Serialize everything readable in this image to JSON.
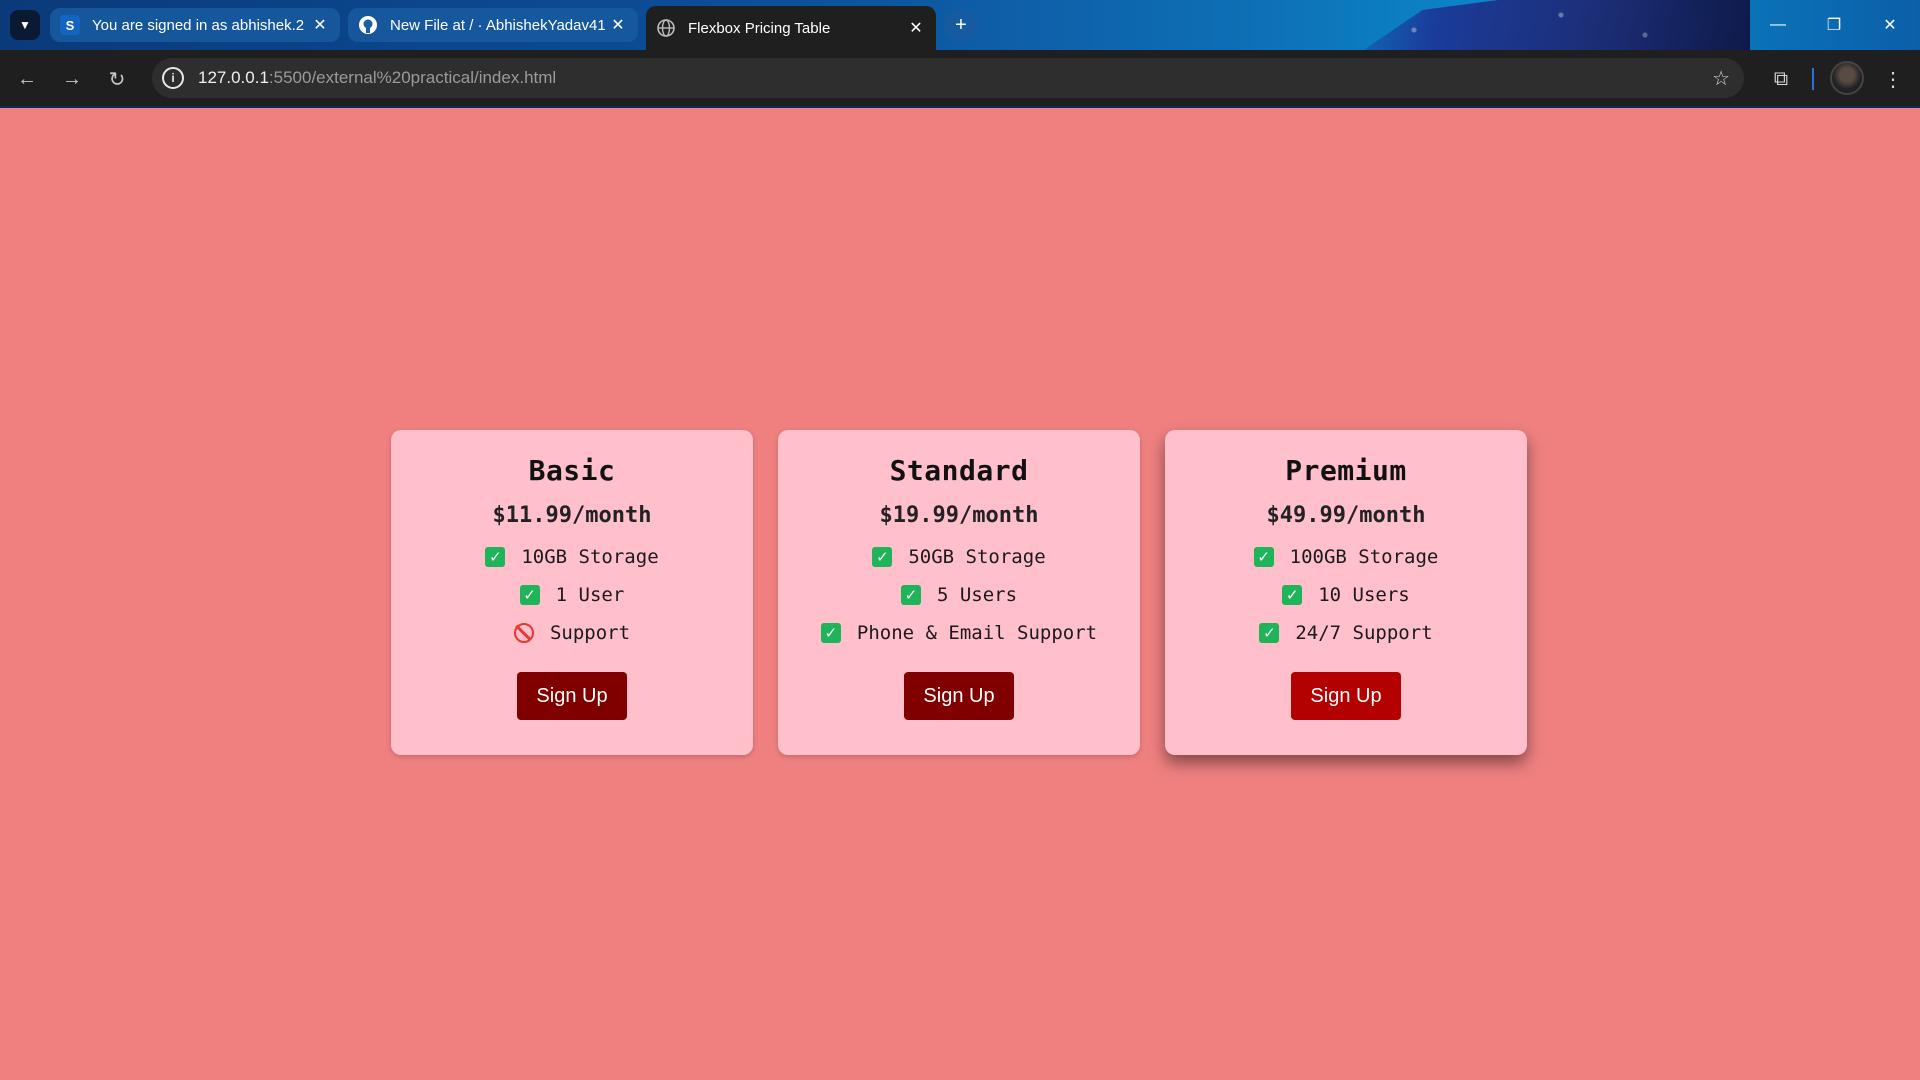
{
  "browser": {
    "tabs": [
      {
        "title": "You are signed in as abhishek.2",
        "favicon": "S",
        "active": false
      },
      {
        "title": "New File at / · AbhishekYadav41",
        "favicon": "github-icon",
        "active": false
      },
      {
        "title": "Flexbox Pricing Table",
        "favicon": "globe-icon",
        "active": true
      }
    ],
    "url_host": "127.0.0.1",
    "url_rest": ":5500/external%20practical/index.html"
  },
  "plans": [
    {
      "name": "Basic",
      "price": "$11.99/month",
      "features": [
        {
          "text": "10GB Storage",
          "included": true
        },
        {
          "text": "1 User",
          "included": true
        },
        {
          "text": "Support",
          "included": false
        }
      ],
      "button": "Sign Up"
    },
    {
      "name": "Standard",
      "price": "$19.99/month",
      "features": [
        {
          "text": "50GB Storage",
          "included": true
        },
        {
          "text": "5 Users",
          "included": true
        },
        {
          "text": "Phone & Email Support",
          "included": true
        }
      ],
      "button": "Sign Up"
    },
    {
      "name": "Premium",
      "price": "$49.99/month",
      "features": [
        {
          "text": "100GB Storage",
          "included": true
        },
        {
          "text": "10 Users",
          "included": true
        },
        {
          "text": "24/7 Support",
          "included": true
        }
      ],
      "button": "Sign Up"
    }
  ],
  "colors": {
    "page_background": "#f08080",
    "card_background": "#ffc0cb",
    "button": "#800000",
    "button_featured": "#b30000",
    "check": "#1fb45a",
    "unavailable": "#e53935"
  }
}
